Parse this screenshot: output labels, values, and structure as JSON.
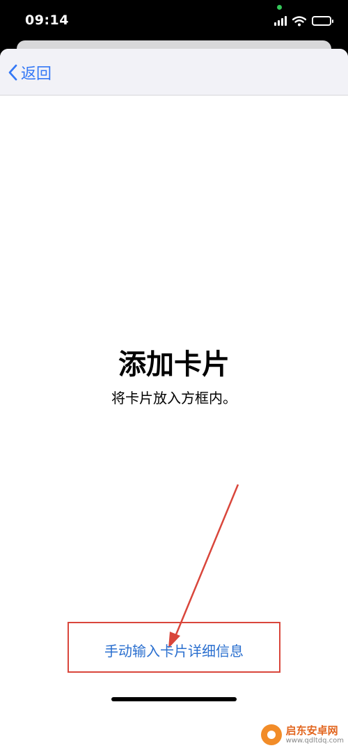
{
  "status_bar": {
    "time": "09:14",
    "icons": [
      "signal-icon",
      "wifi-icon",
      "battery-icon"
    ],
    "camera_indicator_color": "#34c759"
  },
  "nav": {
    "back_label": "返回",
    "accent_color": "#3478f6"
  },
  "content": {
    "title": "添加卡片",
    "subtitle": "将卡片放入方框内。"
  },
  "actions": {
    "manual_entry_label": "手动输入卡片详细信息",
    "link_color": "#2a6fcf",
    "highlight_color": "#d9463b"
  },
  "watermark": {
    "name": "启东安卓网",
    "url": "www.qdltdq.com"
  }
}
